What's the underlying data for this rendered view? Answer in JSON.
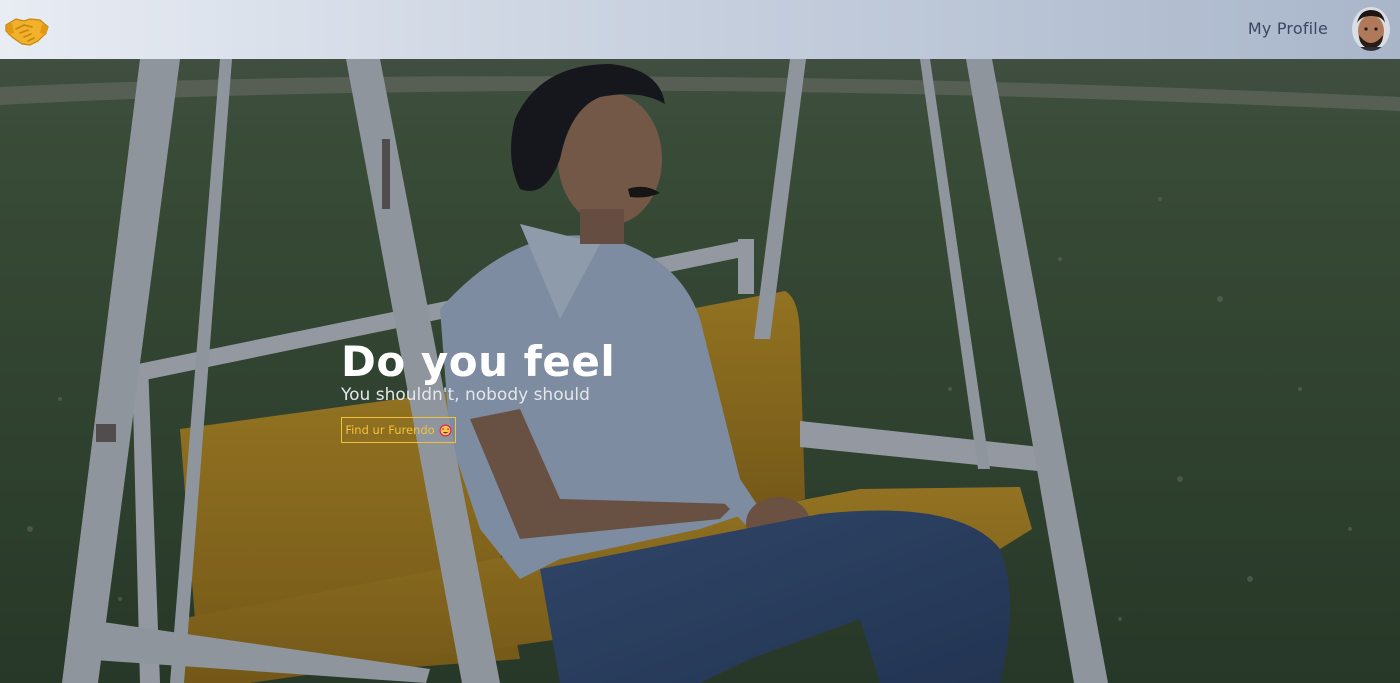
{
  "navbar": {
    "logo_icon": "handshake-icon",
    "profile_link": "My Profile",
    "avatar_icon": "user-avatar"
  },
  "hero": {
    "title": "Do you feel",
    "subtitle": "You shouldn't, nobody should",
    "cta_label": "Find ur Furendo",
    "cta_emoji_icon": "heart-eyes-emoji",
    "background": "man-sitting-alone-on-swing-bench"
  },
  "colors": {
    "accent": "#f3c23d",
    "nav_text": "#3b4660",
    "hero_text": "#ffffff"
  }
}
